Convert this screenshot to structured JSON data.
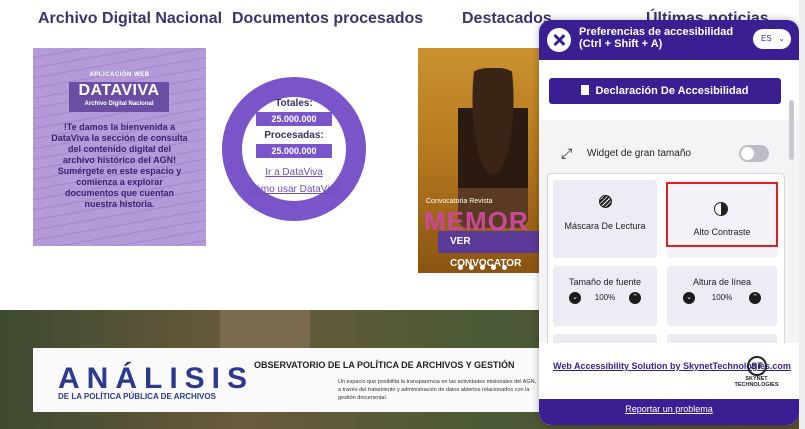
{
  "sections": {
    "archivo": "Archivo Digital Nacional",
    "documentos": "Documentos procesados",
    "destacados": "Destacados",
    "noticias": "Últimas noticias"
  },
  "dataviva": {
    "tag": "APLICACIÓN WEB",
    "logo": "DATAVIVA",
    "logo_sub": "Archivo Digital Nacional",
    "text": "!Te damos la bienvenida a DataViva la sección de consulta del contenido digital del archivo histórico del AGN! Sumérgete en este espacio y comienza a explorar documentos que cuentan nuestra historia."
  },
  "documentos": {
    "totales_label": "Totales:",
    "totales_value": "25.000.000",
    "procesadas_label": "Procesadas:",
    "procesadas_value": "25.000.000",
    "link_ir": "Ir a DataViva",
    "link_como": "Cómo usar DataViva",
    "ring_color": "#7a55c9"
  },
  "destacados": {
    "convocatoria": "Convocatoria Revista",
    "memoria": "MEMOR",
    "button": "VER CONVOCATOR"
  },
  "banner": {
    "analisis": "ANÁLISIS",
    "analisis_sub": "DE LA POLÍTICA PÚBLICA DE ARCHIVOS",
    "obs_title": "OBSERVATORIO DE LA POLÍTICA DE ARCHIVOS Y GESTIÓN",
    "obs_desc": "Un espacio que posibilita la transparencia en las actividades misionales del AGN, a través del tratamiento y administración de datos abiertos relacionados con la gestión documental."
  },
  "accessibility": {
    "title": "Preferencias de accesibilidad",
    "shortcut": "(Ctrl + Shift + A)",
    "lang": "ES",
    "declaration_button": "Declaración De Accesibilidad",
    "big_widget_label": "Widget de gran tamaño",
    "mask_label": "Máscara De Lectura",
    "contrast_label": "Alto Contraste",
    "font_size_label": "Tamaño de fuente",
    "font_size_value": "100%",
    "line_height_label": "Altura de línea",
    "line_height_value": "100%",
    "skynet_link": "Web Accessibility Solution by SkynetTechnologies.com",
    "skynet_name": "SKYNET TECHNOLOGIES",
    "skynet_mark": "ST",
    "report_link": "Reportar un problema",
    "brand_color": "#3a1f93"
  }
}
